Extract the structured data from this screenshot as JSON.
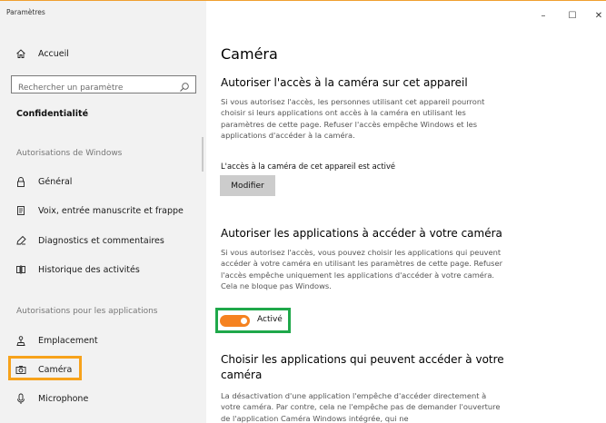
{
  "window": {
    "title": "Paramètres",
    "controls": {
      "minimize": "–",
      "maximize": "☐",
      "close": "✕"
    }
  },
  "sidebar": {
    "home_label": "Accueil",
    "search_placeholder": "Rechercher un paramètre",
    "section_title": "Confidentialité",
    "group_windows": "Autorisations de Windows",
    "windows_items": [
      {
        "label": "Général",
        "icon": "lock-icon"
      },
      {
        "label": "Voix, entrée manuscrite et frappe",
        "icon": "speech-icon"
      },
      {
        "label": "Diagnostics et commentaires",
        "icon": "feedback-icon"
      },
      {
        "label": "Historique des activités",
        "icon": "timeline-icon"
      }
    ],
    "group_apps": "Autorisations pour les applications",
    "app_items": [
      {
        "label": "Emplacement",
        "icon": "location-icon"
      },
      {
        "label": "Caméra",
        "icon": "camera-icon",
        "selected": true
      },
      {
        "label": "Microphone",
        "icon": "microphone-icon"
      }
    ]
  },
  "main": {
    "title": "Caméra",
    "device_section": {
      "heading": "Autoriser l'accès à la caméra sur cet appareil",
      "description": "Si vous autorisez l'accès, les personnes utilisant cet appareil pourront choisir si leurs applications ont accès à la caméra en utilisant les paramètres de cette page. Refuser l'accès empêche Windows et les applications d'accéder à la caméra.",
      "status": "L'accès à la caméra de cet appareil est activé",
      "button_label": "Modifier"
    },
    "apps_section": {
      "heading": "Autoriser les applications à accéder à votre caméra",
      "description": "Si vous autorisez l'accès, vous pouvez choisir les applications qui peuvent accéder à votre caméra en utilisant les paramètres de cette page. Refuser l'accès empêche uniquement les applications d'accéder à votre caméra. Cela ne bloque pas Windows.",
      "toggle_label": "Activé",
      "toggle_on": true
    },
    "choose_section": {
      "heading": "Choisir les applications qui peuvent accéder à votre caméra",
      "description": "La désactivation d'une application l'empêche d'accéder directement à votre caméra. Par contre, cela ne l'empêche pas de demander l'ouverture de l'application Caméra Windows intégrée, qui ne"
    }
  },
  "colors": {
    "accent": "#f58220",
    "highlight_orange": "#f7a21b",
    "highlight_green": "#1fa84a",
    "sidebar_bg": "#f2f2f2"
  }
}
